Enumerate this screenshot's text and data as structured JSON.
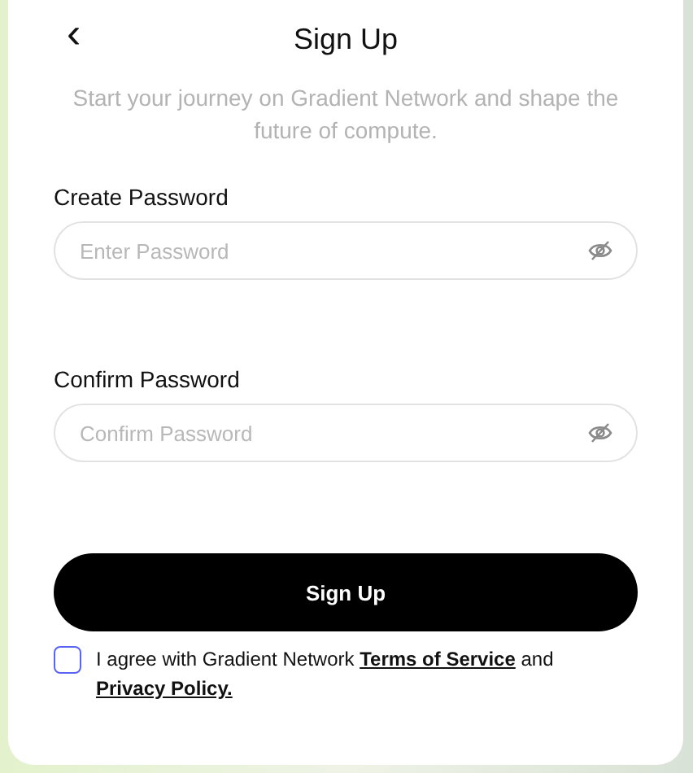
{
  "header": {
    "back": "‹",
    "title": "Sign Up",
    "subtitle": "Start your journey on Gradient Network and shape the future of compute."
  },
  "fields": [
    {
      "label": "Create Password",
      "placeholder": "Enter Password"
    },
    {
      "label": "Confirm Password",
      "placeholder": "Confirm Password"
    }
  ],
  "submit": "Sign Up",
  "agreement": {
    "checked": false,
    "text": "I agree with Gradient Network",
    "terms": "Terms of Service",
    "joiner": "and",
    "privacy": "Privacy Policy."
  }
}
